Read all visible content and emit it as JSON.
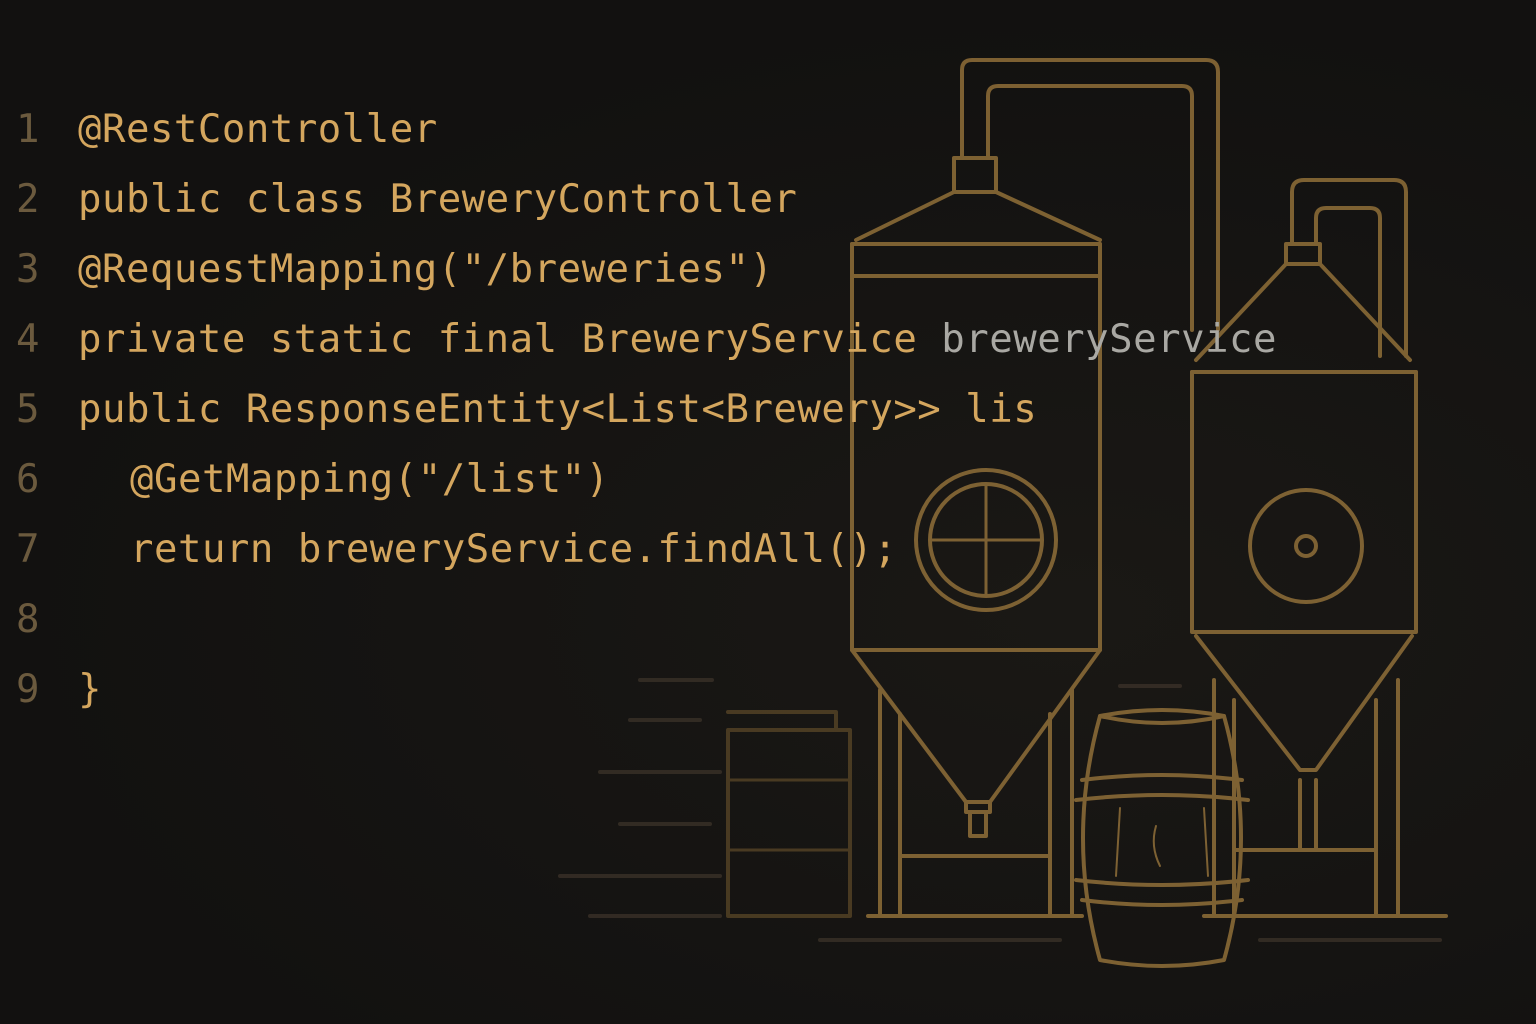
{
  "editor": {
    "lines": [
      {
        "number": "1",
        "text": "@RestController"
      },
      {
        "number": "2",
        "text": "public class BreweryController"
      },
      {
        "number": "3",
        "text": "@RequestMapping(\"/breweries\")"
      },
      {
        "number": "4",
        "text": "private static final BreweryService ",
        "highlight": "breweryService"
      },
      {
        "number": "5",
        "text": "public ResponseEntity<List<Brewery>> lis"
      },
      {
        "number": "6",
        "text": "@GetMapping(\"/list\")"
      },
      {
        "number": "7",
        "text": "return breweryService.findAll();"
      },
      {
        "number": "8",
        "text": ""
      },
      {
        "number": "9",
        "text": "}"
      }
    ]
  },
  "theme": {
    "background": "#131210",
    "code_color": "#d4a65e",
    "line_number_color": "#6b5a3e",
    "highlight_color": "#a9a8a3",
    "illustration_stroke": "#8a6a37"
  },
  "illustration": {
    "subject": "brewery-tanks-and-barrel"
  }
}
